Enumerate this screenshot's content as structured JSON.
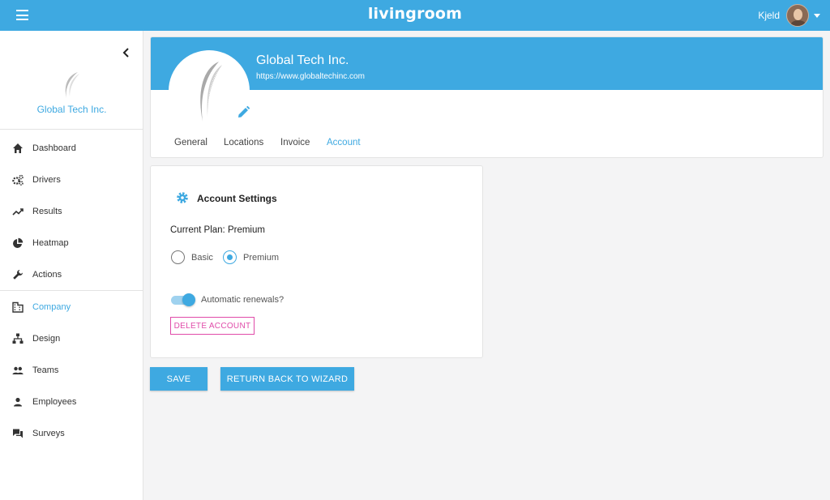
{
  "topbar": {
    "menu_icon": "hamburger-icon",
    "brand": "livingroom",
    "user_name": "Kjeld",
    "brand_color": "#3ea9e1"
  },
  "sidebar": {
    "company_name": "Global Tech Inc.",
    "items": [
      {
        "label": "Dashboard",
        "icon": "home-icon"
      },
      {
        "label": "Drivers",
        "icon": "gears-icon"
      },
      {
        "label": "Results",
        "icon": "trending-up-icon"
      },
      {
        "label": "Heatmap",
        "icon": "pie-chart-icon"
      },
      {
        "label": "Actions",
        "icon": "wrench-icon"
      },
      {
        "label": "Company",
        "icon": "building-icon",
        "active": true
      },
      {
        "label": "Design",
        "icon": "org-chart-icon"
      },
      {
        "label": "Teams",
        "icon": "people-icon"
      },
      {
        "label": "Employees",
        "icon": "person-icon"
      },
      {
        "label": "Surveys",
        "icon": "chat-bubbles-icon"
      }
    ]
  },
  "company": {
    "name": "Global Tech Inc.",
    "url": "https://www.globaltechinc.com",
    "tabs": [
      {
        "label": "General"
      },
      {
        "label": "Locations"
      },
      {
        "label": "Invoice"
      },
      {
        "label": "Account",
        "active": true
      }
    ]
  },
  "account": {
    "title": "Account Settings",
    "current_plan": "Current Plan: Premium",
    "options": [
      {
        "label": "Basic",
        "checked": false
      },
      {
        "label": "Premium",
        "checked": true
      }
    ],
    "auto_renewal_label": "Automatic renewals?",
    "auto_renewal_on": true,
    "delete_label": "DELETE ACCOUNT",
    "delete_color": "#e04ba9"
  },
  "actions": {
    "save_label": "SAVE",
    "wizard_label": "RETURN BACK TO WIZARD"
  }
}
